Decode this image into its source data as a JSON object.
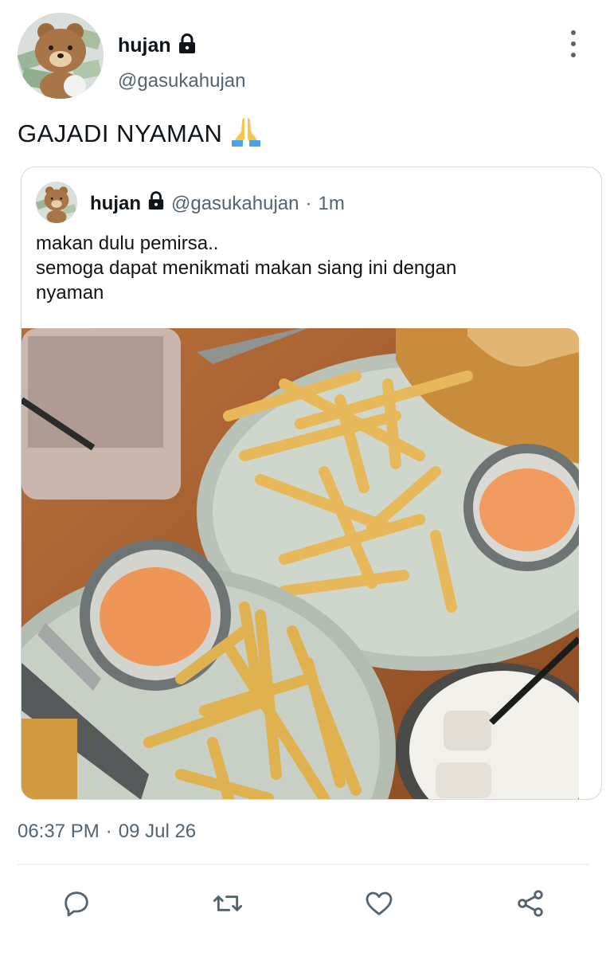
{
  "author": {
    "display_name": "hujan",
    "handle": "@gasukahujan",
    "protected": true,
    "avatar_icon": "bear-with-money-avatar"
  },
  "tweet": {
    "text": "GAJADI NYAMAN",
    "emoji": "🙏",
    "time": "06:37 PM",
    "separator": "·",
    "date": "09 Jul 26"
  },
  "quoted_tweet": {
    "display_name": "hujan",
    "handle": "@gasukahujan",
    "separator": "·",
    "age": "1m",
    "lines": [
      "makan dulu pemirsa..",
      "semoga dapat menikmati makan siang ini dengan",
      "nyaman"
    ],
    "photo_icon": "fries-and-drinks-photo"
  },
  "actions": [
    {
      "name": "reply",
      "icon": "reply-icon"
    },
    {
      "name": "retweet",
      "icon": "retweet-icon"
    },
    {
      "name": "like",
      "icon": "heart-icon"
    },
    {
      "name": "share",
      "icon": "share-icon"
    }
  ],
  "colors": {
    "text_primary": "#0f1419",
    "text_secondary": "#536471",
    "border": "#cfd9de",
    "icon": "#536471"
  }
}
